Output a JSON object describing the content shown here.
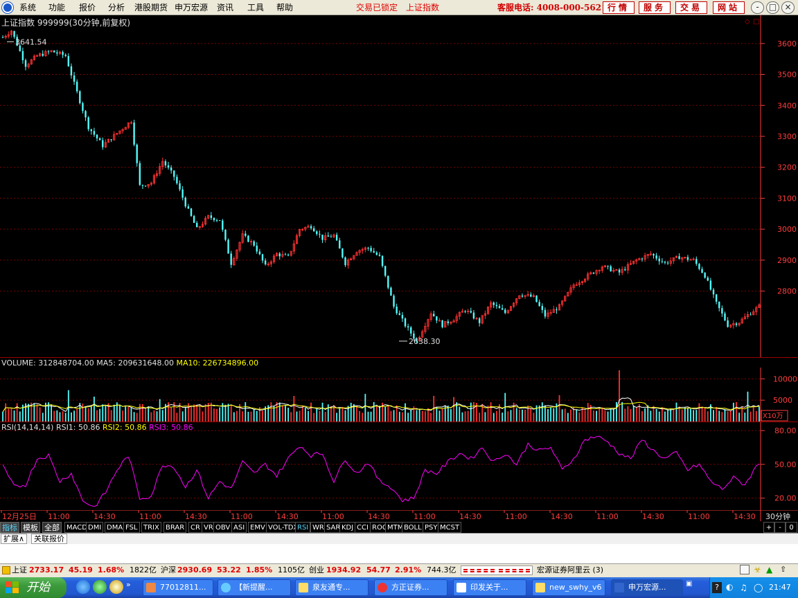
{
  "menu": {
    "items": [
      "系统",
      "功能",
      "报价",
      "分析",
      "港股期货",
      "申万宏源",
      "资讯",
      "工具",
      "帮助"
    ],
    "status_locked": "交易已锁定",
    "status_index": "上证指数",
    "hotline": "客服电话: 4008-000-562",
    "quick_buttons": [
      "行情",
      "服务",
      "交易",
      "网站"
    ]
  },
  "chart": {
    "title": "上证指数 999999(30分钟,前复权)",
    "high_label": "3641.54",
    "low_label": "2638.30",
    "y_ticks": [
      "3600",
      "3500",
      "3400",
      "3300",
      "3200",
      "3100",
      "3000",
      "2900",
      "2800"
    ],
    "volume_title": "VOLUME: 312848704.00",
    "volume_ma5": "MA5: 209631648.00",
    "volume_ma10": "MA10: 226734896.00",
    "volume_ticks": [
      "10000",
      "5000"
    ],
    "volume_unit": "X10万",
    "rsi_title": "RSI(14,14,14)",
    "rsi1": "RSI1: 50.86",
    "rsi2": "RSI2: 50.86",
    "rsi3": "RSI3: 50.86",
    "rsi_ticks": [
      "80.00",
      "50.00",
      "20.00"
    ],
    "x_labels": [
      "12月25日",
      "11:00",
      "14:30",
      "11:00",
      "14:30",
      "11:00",
      "14:30",
      "11:00",
      "14:30",
      "11:00",
      "14:30",
      "11:00",
      "14:30",
      "11:00",
      "14:30",
      "11:00",
      "14:30"
    ],
    "period": "30分钟",
    "colors": {
      "up": "#ff3232",
      "down": "#54fcfc",
      "ma5": "#ffffff",
      "ma10": "#ffff00",
      "rsi": "#ff00ff",
      "axis": "#ff3c3c",
      "grid": "#800000"
    }
  },
  "chart_data": {
    "type": "candlestick",
    "ylim": [
      2600,
      3660
    ],
    "key_points": [
      [
        0,
        3620
      ],
      [
        3,
        3641.54
      ],
      [
        8,
        3530
      ],
      [
        12,
        3560
      ],
      [
        17,
        3575
      ],
      [
        22,
        3560
      ],
      [
        25,
        3470
      ],
      [
        30,
        3330
      ],
      [
        35,
        3270
      ],
      [
        40,
        3310
      ],
      [
        45,
        3350
      ],
      [
        48,
        3140
      ],
      [
        52,
        3150
      ],
      [
        56,
        3220
      ],
      [
        60,
        3170
      ],
      [
        64,
        3080
      ],
      [
        68,
        3000
      ],
      [
        72,
        3040
      ],
      [
        76,
        3030
      ],
      [
        80,
        2890
      ],
      [
        84,
        2980
      ],
      [
        88,
        2950
      ],
      [
        92,
        2880
      ],
      [
        96,
        2920
      ],
      [
        100,
        2910
      ],
      [
        104,
        3000
      ],
      [
        108,
        3010
      ],
      [
        112,
        2970
      ],
      [
        116,
        2980
      ],
      [
        120,
        2890
      ],
      [
        124,
        2930
      ],
      [
        128,
        2940
      ],
      [
        132,
        2910
      ],
      [
        137,
        2750
      ],
      [
        141,
        2690
      ],
      [
        145,
        2638.3
      ],
      [
        150,
        2730
      ],
      [
        154,
        2690
      ],
      [
        158,
        2710
      ],
      [
        162,
        2740
      ],
      [
        167,
        2700
      ],
      [
        171,
        2760
      ],
      [
        176,
        2730
      ],
      [
        181,
        2790
      ],
      [
        186,
        2780
      ],
      [
        190,
        2720
      ],
      [
        195,
        2750
      ],
      [
        200,
        2820
      ],
      [
        205,
        2850
      ],
      [
        210,
        2880
      ],
      [
        216,
        2860
      ],
      [
        222,
        2900
      ],
      [
        227,
        2920
      ],
      [
        232,
        2890
      ],
      [
        237,
        2910
      ],
      [
        242,
        2900
      ],
      [
        246,
        2850
      ],
      [
        250,
        2760
      ],
      [
        254,
        2690
      ],
      [
        258,
        2700
      ],
      [
        262,
        2730
      ],
      [
        265,
        2750
      ]
    ],
    "volume_range": [
      0,
      12000
    ],
    "rsi_range": [
      10,
      85
    ],
    "rsi_key_points": [
      [
        0,
        48
      ],
      [
        4,
        30
      ],
      [
        8,
        32
      ],
      [
        12,
        55
      ],
      [
        16,
        58
      ],
      [
        20,
        35
      ],
      [
        24,
        42
      ],
      [
        28,
        18
      ],
      [
        32,
        12
      ],
      [
        36,
        25
      ],
      [
        40,
        45
      ],
      [
        44,
        58
      ],
      [
        48,
        20
      ],
      [
        52,
        22
      ],
      [
        56,
        50
      ],
      [
        60,
        48
      ],
      [
        64,
        30
      ],
      [
        68,
        45
      ],
      [
        72,
        20
      ],
      [
        76,
        35
      ],
      [
        80,
        28
      ],
      [
        84,
        52
      ],
      [
        88,
        42
      ],
      [
        92,
        50
      ],
      [
        96,
        40
      ],
      [
        100,
        55
      ],
      [
        104,
        67
      ],
      [
        108,
        58
      ],
      [
        112,
        60
      ],
      [
        116,
        35
      ],
      [
        120,
        55
      ],
      [
        124,
        42
      ],
      [
        128,
        52
      ],
      [
        132,
        35
      ],
      [
        136,
        30
      ],
      [
        140,
        18
      ],
      [
        144,
        20
      ],
      [
        148,
        45
      ],
      [
        152,
        42
      ],
      [
        156,
        52
      ],
      [
        160,
        60
      ],
      [
        164,
        55
      ],
      [
        168,
        65
      ],
      [
        172,
        52
      ],
      [
        176,
        60
      ],
      [
        180,
        50
      ],
      [
        184,
        68
      ],
      [
        188,
        62
      ],
      [
        192,
        65
      ],
      [
        196,
        45
      ],
      [
        200,
        55
      ],
      [
        204,
        72
      ],
      [
        208,
        75
      ],
      [
        212,
        70
      ],
      [
        216,
        60
      ],
      [
        220,
        55
      ],
      [
        224,
        72
      ],
      [
        228,
        62
      ],
      [
        232,
        55
      ],
      [
        236,
        60
      ],
      [
        240,
        45
      ],
      [
        244,
        50
      ],
      [
        248,
        35
      ],
      [
        252,
        28
      ],
      [
        256,
        38
      ],
      [
        260,
        32
      ],
      [
        264,
        48
      ],
      [
        265,
        51
      ]
    ]
  },
  "bottom": {
    "left_tabs": [
      "指标",
      "模板",
      "全部"
    ],
    "indicator_tabs": [
      "MACD",
      "DMI",
      "DMA",
      "FSL",
      "TRIX",
      "BRAR",
      "CR",
      "VR",
      "OBV",
      "ASI",
      "EMV",
      "VOL-TDX",
      "RSI",
      "WR",
      "SAR",
      "KDJ",
      "CCI",
      "ROC",
      "MTM",
      "BOLL",
      "PSY",
      "MCST"
    ],
    "active_indicator": "RSI",
    "ctrl": [
      "+",
      "-",
      "0"
    ],
    "ext_tabs": [
      "扩展∧",
      "关联报价"
    ]
  },
  "ticker": {
    "sh_label": "上证",
    "sh_price": "2733.17",
    "sh_chg": "45.19",
    "sh_pct": "1.68%",
    "sh_amt": "1822亿",
    "hs_label": "沪深",
    "hs_price": "2930.69",
    "hs_chg": "53.22",
    "hs_pct": "1.85%",
    "hs_amt": "1105亿",
    "cy_label": "创业",
    "cy_price": "1934.92",
    "cy_chg": "54.77",
    "cy_pct": "2.91%",
    "cy_amt": "744.3亿",
    "server": "宏源证券阿里云 (3)"
  },
  "taskbar": {
    "start": "开始",
    "tasks": [
      "77012811...",
      "【新提醒...",
      "泉友通专...",
      "方正证券...",
      "印发关于...",
      "new_swhy_v6",
      "申万宏源..."
    ],
    "clock": "21:47"
  }
}
